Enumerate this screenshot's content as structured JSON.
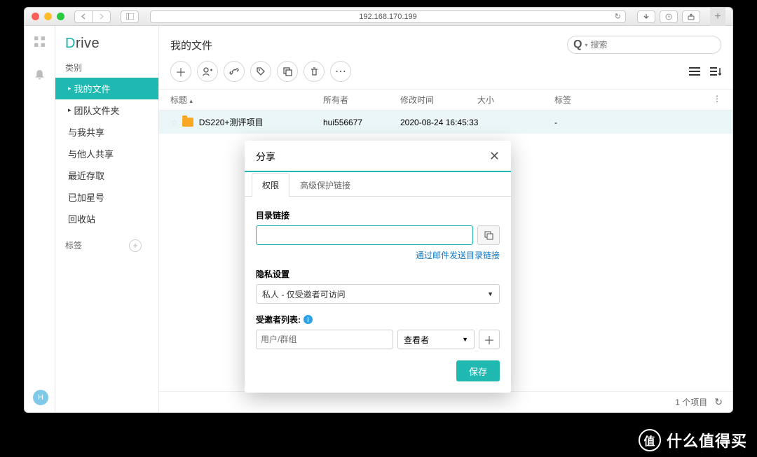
{
  "browser": {
    "url": "192.168.170.199"
  },
  "app": {
    "logo_prefix": "D",
    "logo_rest": "rive"
  },
  "sidebar": {
    "category_label": "类别",
    "items": [
      {
        "label": "我的文件"
      },
      {
        "label": "团队文件夹"
      },
      {
        "label": "与我共享"
      },
      {
        "label": "与他人共享"
      },
      {
        "label": "最近存取"
      },
      {
        "label": "已加星号"
      },
      {
        "label": "回收站"
      }
    ],
    "tags_label": "标签"
  },
  "main": {
    "title": "我的文件",
    "search_placeholder": "搜索",
    "columns": {
      "title": "标题",
      "owner": "所有者",
      "modified": "修改时间",
      "size": "大小",
      "tags": "标签"
    },
    "row": {
      "name": "DS220+测评项目",
      "owner": "hui556677",
      "modified": "2020-08-24 16:45:33",
      "size": "",
      "tags": "-"
    },
    "footer_count": "1 个项目"
  },
  "dialog": {
    "title": "分享",
    "tabs": {
      "perm": "权限",
      "adv": "高级保护链接"
    },
    "link_label": "目录链接",
    "mail_link": "通过邮件发送目录链接",
    "privacy_label": "隐私设置",
    "privacy_value": "私人 - 仅受邀者可访问",
    "invitee_label": "受邀者列表:",
    "invitee_placeholder": "用户/群组",
    "role": "查看者",
    "save": "保存"
  },
  "watermark": "什么值得买",
  "avatar_initial": "H"
}
